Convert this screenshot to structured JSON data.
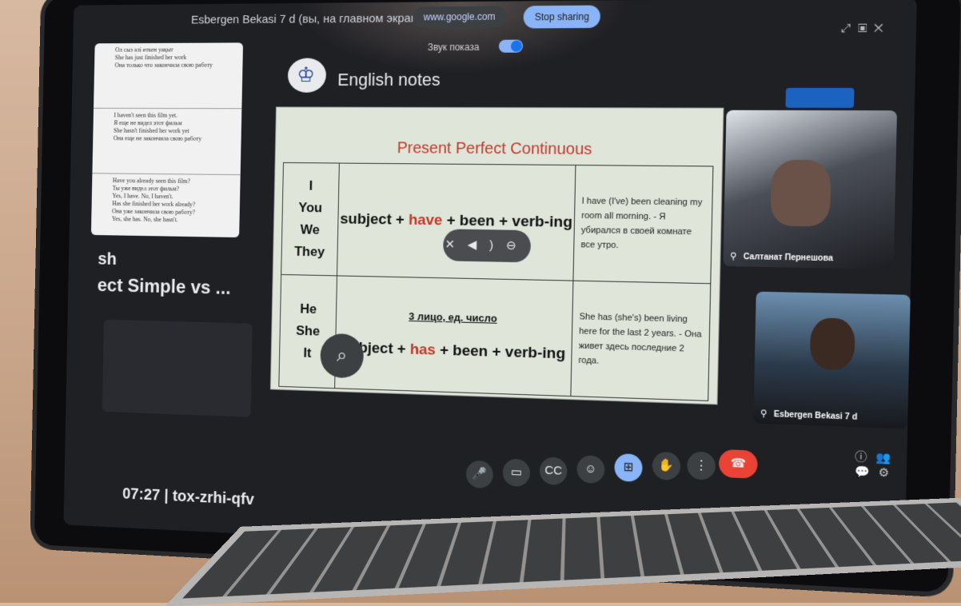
{
  "topbar": {
    "share_title": "Esbergen Bekasi 7 d (вы, на главном экране)",
    "url": "www.google.com",
    "stop_sharing": "Stop sharing",
    "sound_label": "Звук показа",
    "sound_toggle_on": true
  },
  "left_panel": {
    "doc_lines": [
      "Ол сыз әлі өткен уақыт",
      "She has just finished her work",
      "Она только что закончила свою работу",
      "I haven't seen this film yet.",
      "Я еще не видел этот фильм",
      "She hasn't finished her work yet",
      "Она еще не закончила свою работу",
      "Have you already seen this film?",
      "Ты уже видел этот фильм?",
      "Yes, I have. No, I haven't.",
      "Has she finished her work already?",
      "Она уже закончила свою работу?",
      "Yes, she has. No, she hasn't."
    ],
    "title_line1": "sh",
    "title_line2": "ect Simple vs ..."
  },
  "doc": {
    "title": "English notes"
  },
  "slide": {
    "title": "Present Perfect Continuous",
    "rows": [
      {
        "pronouns": [
          "I",
          "You",
          "We",
          "They"
        ],
        "note": "",
        "formula": [
          "subject + ",
          "have",
          " + been + verb-ing"
        ],
        "example": "I have (I've) been cleaning my room all morning. - Я убирался в своей комнате все утро."
      },
      {
        "pronouns": [
          "He",
          "She",
          "It"
        ],
        "note": "3 лицо, ед. число",
        "formula": [
          "subject + ",
          "has",
          " + been + verb-ing"
        ],
        "example": "She has (she's) been living here for the last 2 years. - Она живет здесь последние 2 года."
      }
    ]
  },
  "participants": [
    {
      "name": "Салтанат Пернешова"
    },
    {
      "name": "Esbergen Bekasi 7 d"
    }
  ],
  "footer": {
    "time": "07:27",
    "separator": "|",
    "meeting_code": "tox-zrhi-qfv"
  },
  "colors": {
    "accent": "#8ab4f8",
    "red": "#c0392b",
    "end_call": "#ea4335",
    "slide_bg": "#dfe6d9"
  }
}
